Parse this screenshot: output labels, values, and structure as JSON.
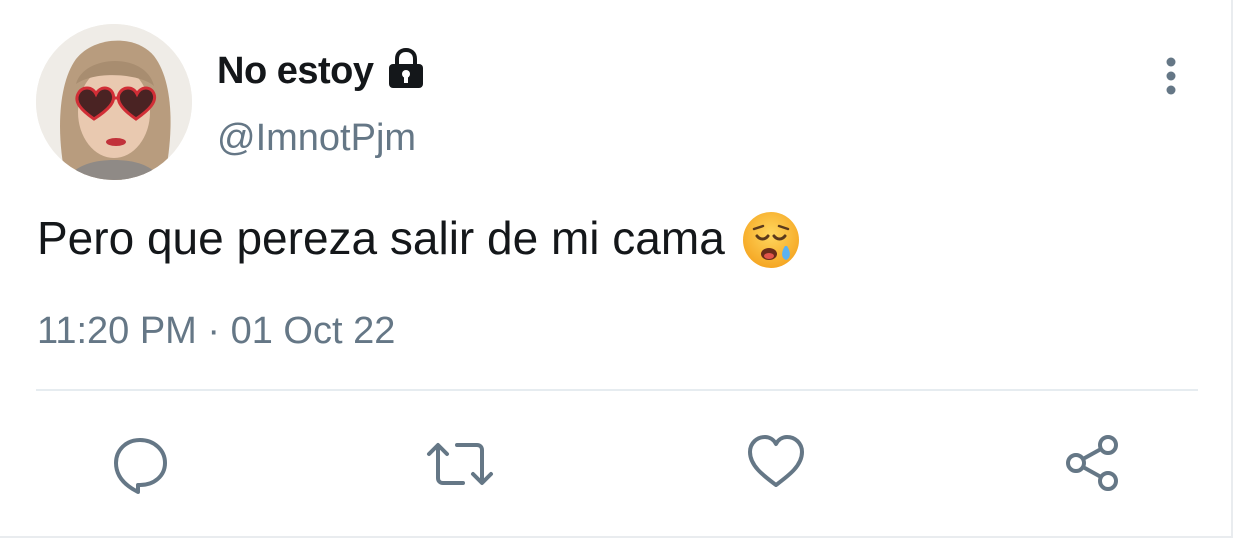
{
  "tweet": {
    "author": {
      "display_name": "No estoy",
      "handle": "@ImnotPjm",
      "protected_icon": "lock-icon",
      "avatar_icon": "avatar"
    },
    "text": "Pero que pereza salir de mi cama",
    "emoji_icon": "sleepy-face-emoji",
    "timestamp": "11:20 PM · 01 Oct 22"
  },
  "actions": [
    {
      "icon": "reply-icon"
    },
    {
      "icon": "retweet-icon"
    },
    {
      "icon": "like-icon"
    },
    {
      "icon": "share-icon"
    }
  ],
  "menu_icon": "more-vertical-icon",
  "colors": {
    "text_primary": "#14171a",
    "text_secondary": "#657786",
    "divider": "#e6ecf0",
    "icon": "#657786"
  }
}
